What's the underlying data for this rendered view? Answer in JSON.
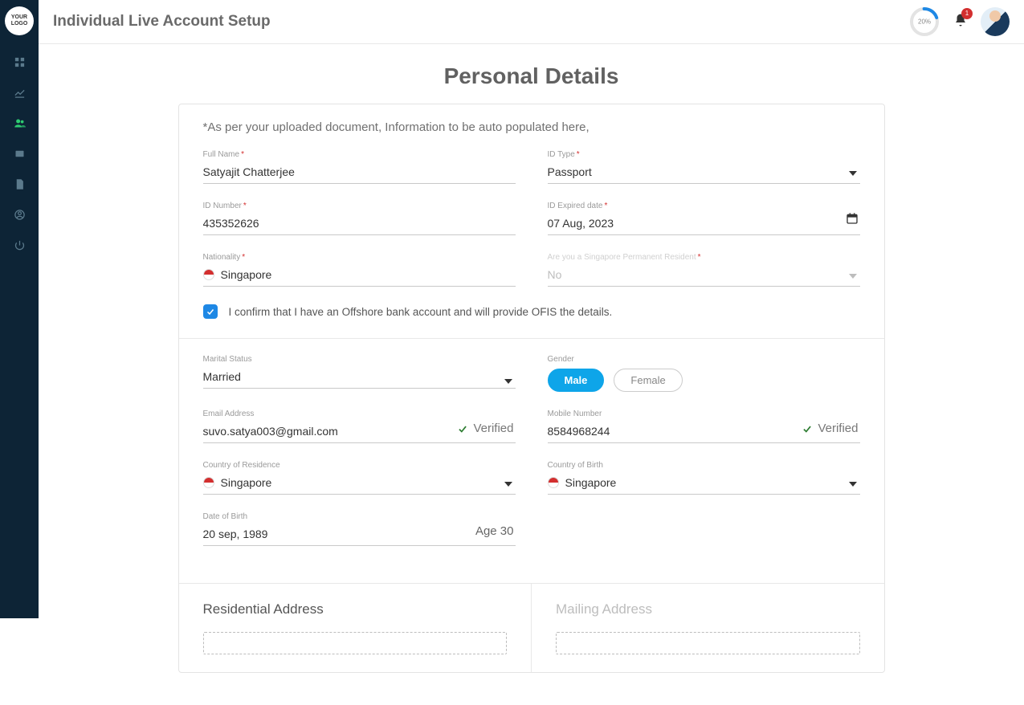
{
  "app": {
    "logo_text": "YOUR LOGO"
  },
  "header": {
    "title": "Individual Live Account Setup",
    "progress_pct": "20%",
    "notifications": "1"
  },
  "page": {
    "title": "Personal Details",
    "note": "*As per your uploaded document, Information to be auto populated here,"
  },
  "labels": {
    "full_name": "Full Name",
    "id_type": "ID Type",
    "id_number": "ID Number",
    "id_expired": "ID Expired date",
    "nationality": "Nationality",
    "sg_pr": "Are you a Singapore Permanent Resident",
    "marital": "Marital Status",
    "gender": "Gender",
    "email": "Email Address",
    "mobile": "Mobile Number",
    "country_res": "Country of Residence",
    "country_birth": "Country of Birth",
    "dob": "Date of Birth",
    "verified": "Verified",
    "male": "Male",
    "female": "Female",
    "residential_addr": "Residential Address",
    "mailing_addr": "Mailing Address",
    "offshore_confirm": "I confirm that I have an Offshore bank account and will provide OFIS the details."
  },
  "values": {
    "full_name": "Satyajit Chatterjee",
    "id_type": "Passport",
    "id_number": "435352626",
    "id_expired": "07 Aug, 2023",
    "nationality": "Singapore",
    "sg_pr": "No",
    "marital": "Married",
    "email": "suvo.satya003@gmail.com",
    "mobile": "8584968244",
    "country_res": "Singapore",
    "country_birth": "Singapore",
    "dob": "20 sep, 1989",
    "age": "Age 30"
  }
}
